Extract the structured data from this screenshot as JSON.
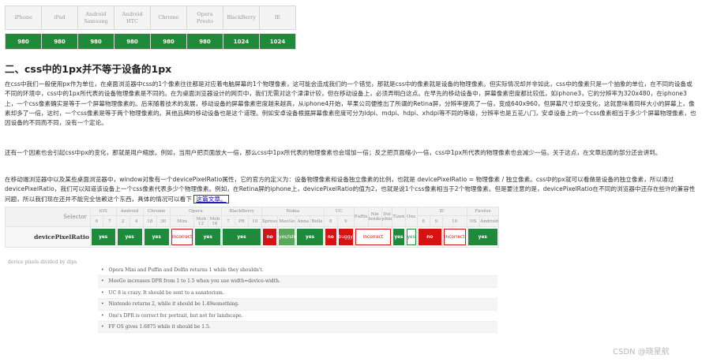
{
  "devices_table": {
    "headers": [
      "iPhone",
      "iPad",
      "Android Samsung",
      "Android HTC",
      "Chrome",
      "Opera Presto",
      "BlackBerry",
      "IE"
    ],
    "values": [
      "980",
      "980",
      "980",
      "980",
      "980",
      "980",
      "1024",
      "1024"
    ]
  },
  "heading": "二、css中的1px并不等于设备的1px",
  "paragraphs": [
    "在css中我们一般使用px作为单位，在桌面浏览器中css的1个像素往往都是对应着电脑屏幕的1个物理像素，这可能会造成我们的一个错觉，那就是css中的像素就是设备的物理像素。但实际情况却并非如此，css中的像素只是一个抽象的单位，在不同的设备或不同的环境中，css中的1px所代表的设备物理像素是不同的。在为桌面浏览器设计的网页中，我们无需对这个津津计较，但在移动设备上，必须弄明白这点。在早先的移动设备中，屏幕像素密度都比较低，如iphone3，它的分辨率为320x480，在iphone3上，一个css像素确实是等于一个屏幕物理像素的。后来随着技术的发展，移动设备的屏幕像素密度越来越高，从iphone4开始，苹果公司便推出了所谓的Retina屏，分辨率提高了一倍，变成640x960，但屏幕尺寸却没变化，这就意味着同样大小的屏幕上，像素却多了一倍，这时，一个css像素是等于两个物理像素的。其他品牌的移动设备也是这个道理。例如安卓设备根据屏幕像素密度可分为ldpi、mdpi、hdpi、xhdpi等不同的等级，分辨率也是五花八门，安卓设备上的一个css像素相当于多少个屏幕物理像素，也因设备的不同而不同，没有一个定论。",
    "还有一个因素也会引起css中px的变化，那就是用户缩放。例如，当用户把页面放大一倍，那么css中1px所代表的物理像素也会增加一倍；反之把页面缩小一倍，css中1px所代表的物理像素也会减少一倍。关于这点，在文章后面的部分还会讲到。",
    "在移动端浏览器中以及某些桌面浏览器中，window对象有一个devicePixelRatio属性，它的官方的定义为：设备物理像素和设备独立像素的比例，也就是 devicePixelRatio = 物理像素 / 独立像素。css中的px就可以看做是设备的独立像素，所以通过devicePixelRatio，我们可以知道该设备上一个css像素代表多少个物理像素。例如，在Retina屏的iphone上，devicePixelRatio的值为2，也就是说1个css像素相当于2个物理像素。但是要注意的是，devicePixelRatio在不同的浏览器中还存在些许的兼容性问题，所以我们现在还并不能完全信赖这个东西，具体的情况可以看下"
  ],
  "link_text": "这篇文章。",
  "compat": {
    "selector_label": "Selector",
    "brands": [
      "iOS",
      "Android",
      "Chrome",
      "Opera",
      "BlackBerry",
      "Nokia",
      "UC",
      "Puffin",
      "Nintendo",
      "Dolphin",
      "Tizen",
      "One",
      "IE",
      "Firefox"
    ],
    "versions": [
      "6",
      "7",
      "2",
      "4",
      "18",
      "30",
      "Mini",
      "Mob 12",
      "Mob 16",
      "7",
      "PB",
      "10",
      "Xpress",
      "MeeGo",
      "Anna",
      "Belle",
      "8",
      "9",
      "",
      "Nin tendo",
      "Dol phin",
      "",
      "",
      "8",
      "9",
      "10",
      "OS",
      "Android"
    ],
    "feature": "devicePixelRatio",
    "feature_desc": "device pixels divided by dips",
    "cells": [
      "yes",
      "yes",
      "yes",
      "incorrect",
      "yes",
      "yes",
      "yes",
      "no",
      "yes/ish",
      "yes",
      "yes",
      "no",
      "buggy",
      "yes",
      "incorrect",
      "yes",
      "yes",
      "no",
      "incorrect",
      "yes"
    ],
    "notes": [
      "Opera Mini and Puffin and Dolfin returns 1 while they shouldn't.",
      "MeeGo increases DPR from 1 to 1.5 when you use width=device-width.",
      "UC 8 is crazy. It should be sent to a sanatorium.",
      "Nintendo returns 2, while it should be 1.49something.",
      "One's DPR is correct for portrait, but not for landscape.",
      "FF OS gives 1.6875 while it should be 1.5."
    ]
  },
  "watermark": "CSDN @晓星航"
}
